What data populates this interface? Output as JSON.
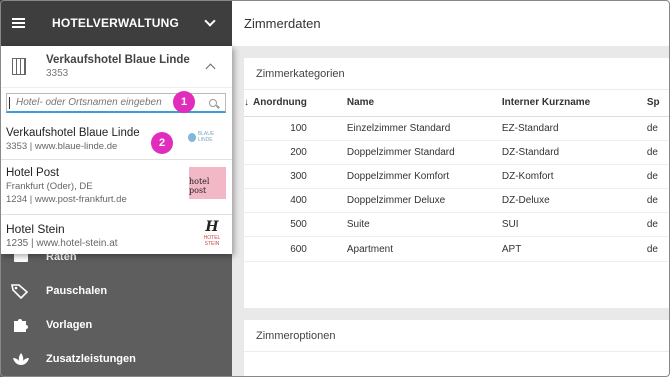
{
  "app": {
    "title": "HOTELVERWALTUNG"
  },
  "hotel_selector": {
    "current_name": "Verkaufshotel Blaue Linde",
    "current_number": "3353",
    "search_placeholder": "Hotel- oder Ortsnamen eingeben",
    "results": [
      {
        "name": "Verkaufshotel Blaue Linde",
        "sub1": "3353 | www.blaue-linde.de",
        "logo_text": "BLAUE LINDE"
      },
      {
        "name": "Hotel Post",
        "sub1": "Frankfurt (Oder), DE",
        "sub2": "1234 | www.post-frankfurt.de",
        "logo_text": "hotel post"
      },
      {
        "name": "Hotel Stein",
        "sub1": "1235 | www.hotel-stein.at",
        "logo_letter": "H",
        "logo_text": "HOTEL STEIN"
      }
    ]
  },
  "badges": {
    "one": "1",
    "two": "2"
  },
  "sidebar": {
    "items": [
      {
        "label": "Raten",
        "icon": "rates-icon"
      },
      {
        "label": "Pauschalen",
        "icon": "tag-icon"
      },
      {
        "label": "Vorlagen",
        "icon": "puzzle-icon"
      },
      {
        "label": "Zusatzleistungen",
        "icon": "lotus-icon"
      }
    ]
  },
  "main": {
    "title": "Zimmerdaten",
    "kategorien": {
      "title": "Zimmerkategorien",
      "columns": [
        "Anordnung",
        "Name",
        "Interner Kurzname",
        "Sp"
      ],
      "rows": [
        {
          "order": "100",
          "name": "Einzelzimmer Standard",
          "short": "EZ-Standard",
          "lang": "de"
        },
        {
          "order": "200",
          "name": "Doppelzimmer Standard",
          "short": "DZ-Standard",
          "lang": "de"
        },
        {
          "order": "300",
          "name": "Doppelzimmer Komfort",
          "short": "DZ-Komfort",
          "lang": "de"
        },
        {
          "order": "400",
          "name": "Doppelzimmer Deluxe",
          "short": "DZ-Deluxe",
          "lang": "de"
        },
        {
          "order": "500",
          "name": "Suite",
          "short": "SUI",
          "lang": "de"
        },
        {
          "order": "600",
          "name": "Apartment",
          "short": "APT",
          "lang": "de"
        }
      ]
    },
    "optionen": {
      "title": "Zimmeroptionen"
    }
  },
  "colors": {
    "accent": "#3d9bd9",
    "badge": "#e02dbb",
    "sidebar": "#5e5e5e",
    "topbar": "#3e3e3e"
  }
}
